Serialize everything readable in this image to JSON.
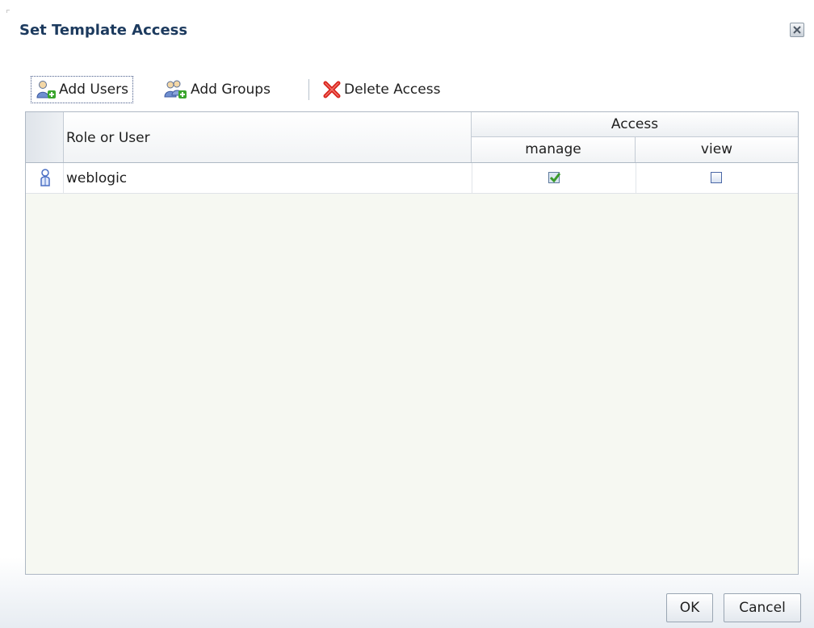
{
  "dialog": {
    "title": "Set Template Access"
  },
  "toolbar": {
    "add_users_label": "Add Users",
    "add_groups_label": "Add Groups",
    "delete_access_label": "Delete Access"
  },
  "table": {
    "columns": {
      "role_or_user": "Role or User",
      "access": "Access",
      "manage": "manage",
      "view": "view"
    },
    "rows": [
      {
        "name": "weblogic",
        "manage": true,
        "view": false
      }
    ]
  },
  "buttons": {
    "ok_label": "OK",
    "cancel_label": "Cancel"
  },
  "colors": {
    "title": "#1c3a5e",
    "check_green": "#3a9a2a",
    "delete_red": "#d8231c"
  }
}
